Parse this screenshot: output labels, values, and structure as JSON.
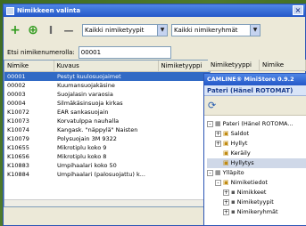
{
  "window": {
    "title": "Nimikkeen valinta"
  },
  "toolbar": {
    "type_filter": "Kaikki nimiketyypit",
    "group_filter": "Kaikki nimikeryhmät"
  },
  "search": {
    "label": "Etsi nimikenumerolla:",
    "value": "00001"
  },
  "grid": {
    "headers": [
      "Nimike",
      "Kuvaus",
      "Nimiketyyppi",
      "Nimike"
    ],
    "rows": [
      [
        "00001",
        "Pestyt kuulosuojaimet"
      ],
      [
        "00002",
        "Kuumansuojakäsine"
      ],
      [
        "00003",
        "Suojalasin varaosia"
      ],
      [
        "00004",
        "Silmäkäsinsuoja kirkas"
      ],
      [
        "K10072",
        "EAR sankasuojain"
      ],
      [
        "K10073",
        "Korvatulppa nauhalla"
      ],
      [
        "K10074",
        "Kangask. \"näppylä\" Naisten"
      ],
      [
        "K10079",
        "Polysuojain 3M 9322"
      ],
      [
        "K10655",
        "Mikrotiplu koko 9"
      ],
      [
        "K10656",
        "Mikrotiplu koko 8"
      ],
      [
        "K10883",
        "Umpihaalari koko 50"
      ],
      [
        "K10884",
        "Umpihaalari (palosuojattu) k..."
      ]
    ]
  },
  "overlay": {
    "title": "CAMLINE® MiniStore 0.9.2",
    "subtitle": "Pateri (Hänel ROTOMAT)",
    "tree": [
      {
        "label": "Pateri (Hänel ROTOMA...",
        "level": 0,
        "exp": "-"
      },
      {
        "label": "Saldot",
        "level": 1,
        "exp": "+"
      },
      {
        "label": "Hyllyt",
        "level": 1,
        "exp": "+"
      },
      {
        "label": "Keräily",
        "level": 1,
        "exp": ""
      },
      {
        "label": "Hyllytys",
        "level": 1,
        "exp": ""
      },
      {
        "label": "Ylläpito",
        "level": 0,
        "exp": "-"
      },
      {
        "label": "Nimiketiedot",
        "level": 1,
        "exp": "-"
      },
      {
        "label": "Nimikkeet",
        "level": 2,
        "exp": "+"
      },
      {
        "label": "Nimiketyypit",
        "level": 2,
        "exp": "+"
      },
      {
        "label": "Nimikeryhmät",
        "level": 2,
        "exp": "+"
      }
    ]
  }
}
